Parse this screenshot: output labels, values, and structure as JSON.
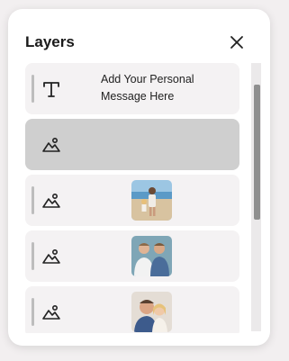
{
  "panel": {
    "title": "Layers",
    "close_icon": "close-icon"
  },
  "layers": [
    {
      "type": "text",
      "icon": "text-icon",
      "label": "Add Your Personal Message Here",
      "selected": false
    },
    {
      "type": "image",
      "icon": "image-icon",
      "label": "",
      "selected": true
    },
    {
      "type": "image",
      "icon": "image-icon",
      "thumbnail": "beach-photo",
      "selected": false
    },
    {
      "type": "image",
      "icon": "image-icon",
      "thumbnail": "two-men-photo",
      "selected": false
    },
    {
      "type": "image",
      "icon": "image-icon",
      "thumbnail": "father-daughter-photo",
      "selected": false
    }
  ],
  "colors": {
    "selected_row": "#cfcfcf",
    "row": "#f4f2f3",
    "scrollbar_thumb": "#8f8f8f"
  }
}
